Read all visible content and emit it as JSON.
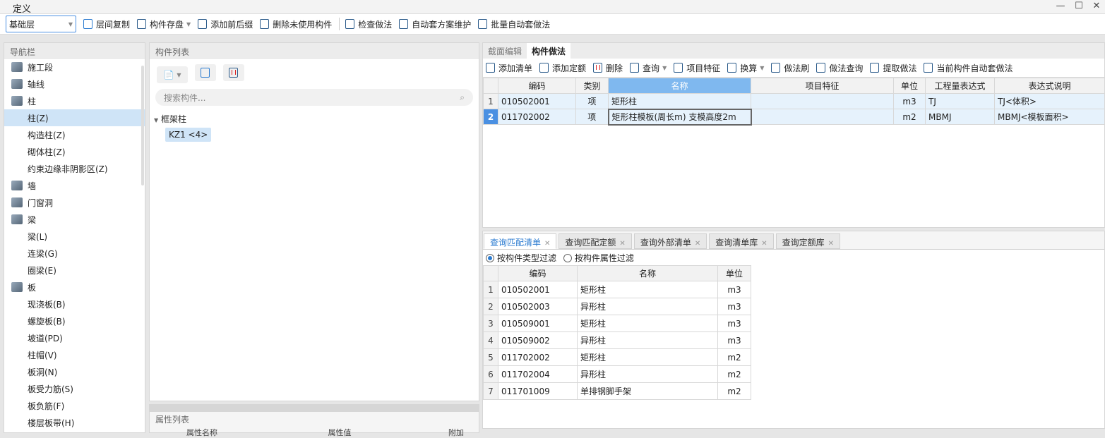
{
  "window": {
    "title": "定义",
    "minimize": "—",
    "maximize": "☐",
    "close": "✕"
  },
  "toolbar": {
    "floor": "基础层",
    "items": [
      "层间复制",
      "构件存盘",
      "添加前后缀",
      "删除未使用构件",
      "检查做法",
      "自动套方案维护",
      "批量自动套做法"
    ]
  },
  "nav": {
    "title": "导航栏",
    "items": [
      {
        "label": "施工段",
        "level": 0
      },
      {
        "label": "轴线",
        "level": 0
      },
      {
        "label": "柱",
        "level": 0
      },
      {
        "label": "柱(Z)",
        "level": 1,
        "selected": true
      },
      {
        "label": "构造柱(Z)",
        "level": 1
      },
      {
        "label": "砌体柱(Z)",
        "level": 1
      },
      {
        "label": "约束边缘非阴影区(Z)",
        "level": 1
      },
      {
        "label": "墙",
        "level": 0
      },
      {
        "label": "门窗洞",
        "level": 0
      },
      {
        "label": "梁",
        "level": 0
      },
      {
        "label": "梁(L)",
        "level": 1
      },
      {
        "label": "连梁(G)",
        "level": 1
      },
      {
        "label": "圈梁(E)",
        "level": 1
      },
      {
        "label": "板",
        "level": 0
      },
      {
        "label": "现浇板(B)",
        "level": 1
      },
      {
        "label": "螺旋板(B)",
        "level": 1
      },
      {
        "label": "坡道(PD)",
        "level": 1
      },
      {
        "label": "柱帽(V)",
        "level": 1
      },
      {
        "label": "板洞(N)",
        "level": 1
      },
      {
        "label": "板受力筋(S)",
        "level": 1
      },
      {
        "label": "板负筋(F)",
        "level": 1
      },
      {
        "label": "楼层板带(H)",
        "level": 1
      }
    ]
  },
  "component_list": {
    "title": "构件列表",
    "search_placeholder": "搜索构件...",
    "group": "框架柱",
    "item": "KZ1 <4>"
  },
  "property_list": {
    "title": "属性列表",
    "columns": [
      "属性名称",
      "属性值",
      "附加"
    ]
  },
  "method": {
    "tabs": [
      "截面编辑",
      "构件做法"
    ],
    "toolbar": [
      "添加清单",
      "添加定额",
      "删除",
      "查询",
      "项目特征",
      "换算",
      "做法刷",
      "做法查询",
      "提取做法",
      "当前构件自动套做法"
    ],
    "columns": [
      "编码",
      "类别",
      "名称",
      "项目特征",
      "单位",
      "工程量表达式",
      "表达式说明"
    ],
    "rows": [
      [
        "1",
        "010502001",
        "项",
        "矩形柱",
        "",
        "m3",
        "TJ",
        "TJ<体积>"
      ],
      [
        "2",
        "011702002",
        "项",
        "矩形柱模板(周长m) 支模高度2m",
        "",
        "m2",
        "MBMJ",
        "MBMJ<模板面积>"
      ]
    ]
  },
  "query": {
    "tabs": [
      "查询匹配清单",
      "查询匹配定额",
      "查询外部清单",
      "查询清单库",
      "查询定额库"
    ],
    "filters": [
      "按构件类型过滤",
      "按构件属性过滤"
    ],
    "columns": [
      "编码",
      "名称",
      "单位"
    ],
    "rows": [
      [
        "1",
        "010502001",
        "矩形柱",
        "m3"
      ],
      [
        "2",
        "010502003",
        "异形柱",
        "m3"
      ],
      [
        "3",
        "010509001",
        "矩形柱",
        "m3"
      ],
      [
        "4",
        "010509002",
        "异形柱",
        "m3"
      ],
      [
        "5",
        "011702002",
        "矩形柱",
        "m2"
      ],
      [
        "6",
        "011702004",
        "异形柱",
        "m2"
      ],
      [
        "7",
        "011701009",
        "单排钢脚手架",
        "m2"
      ]
    ]
  }
}
